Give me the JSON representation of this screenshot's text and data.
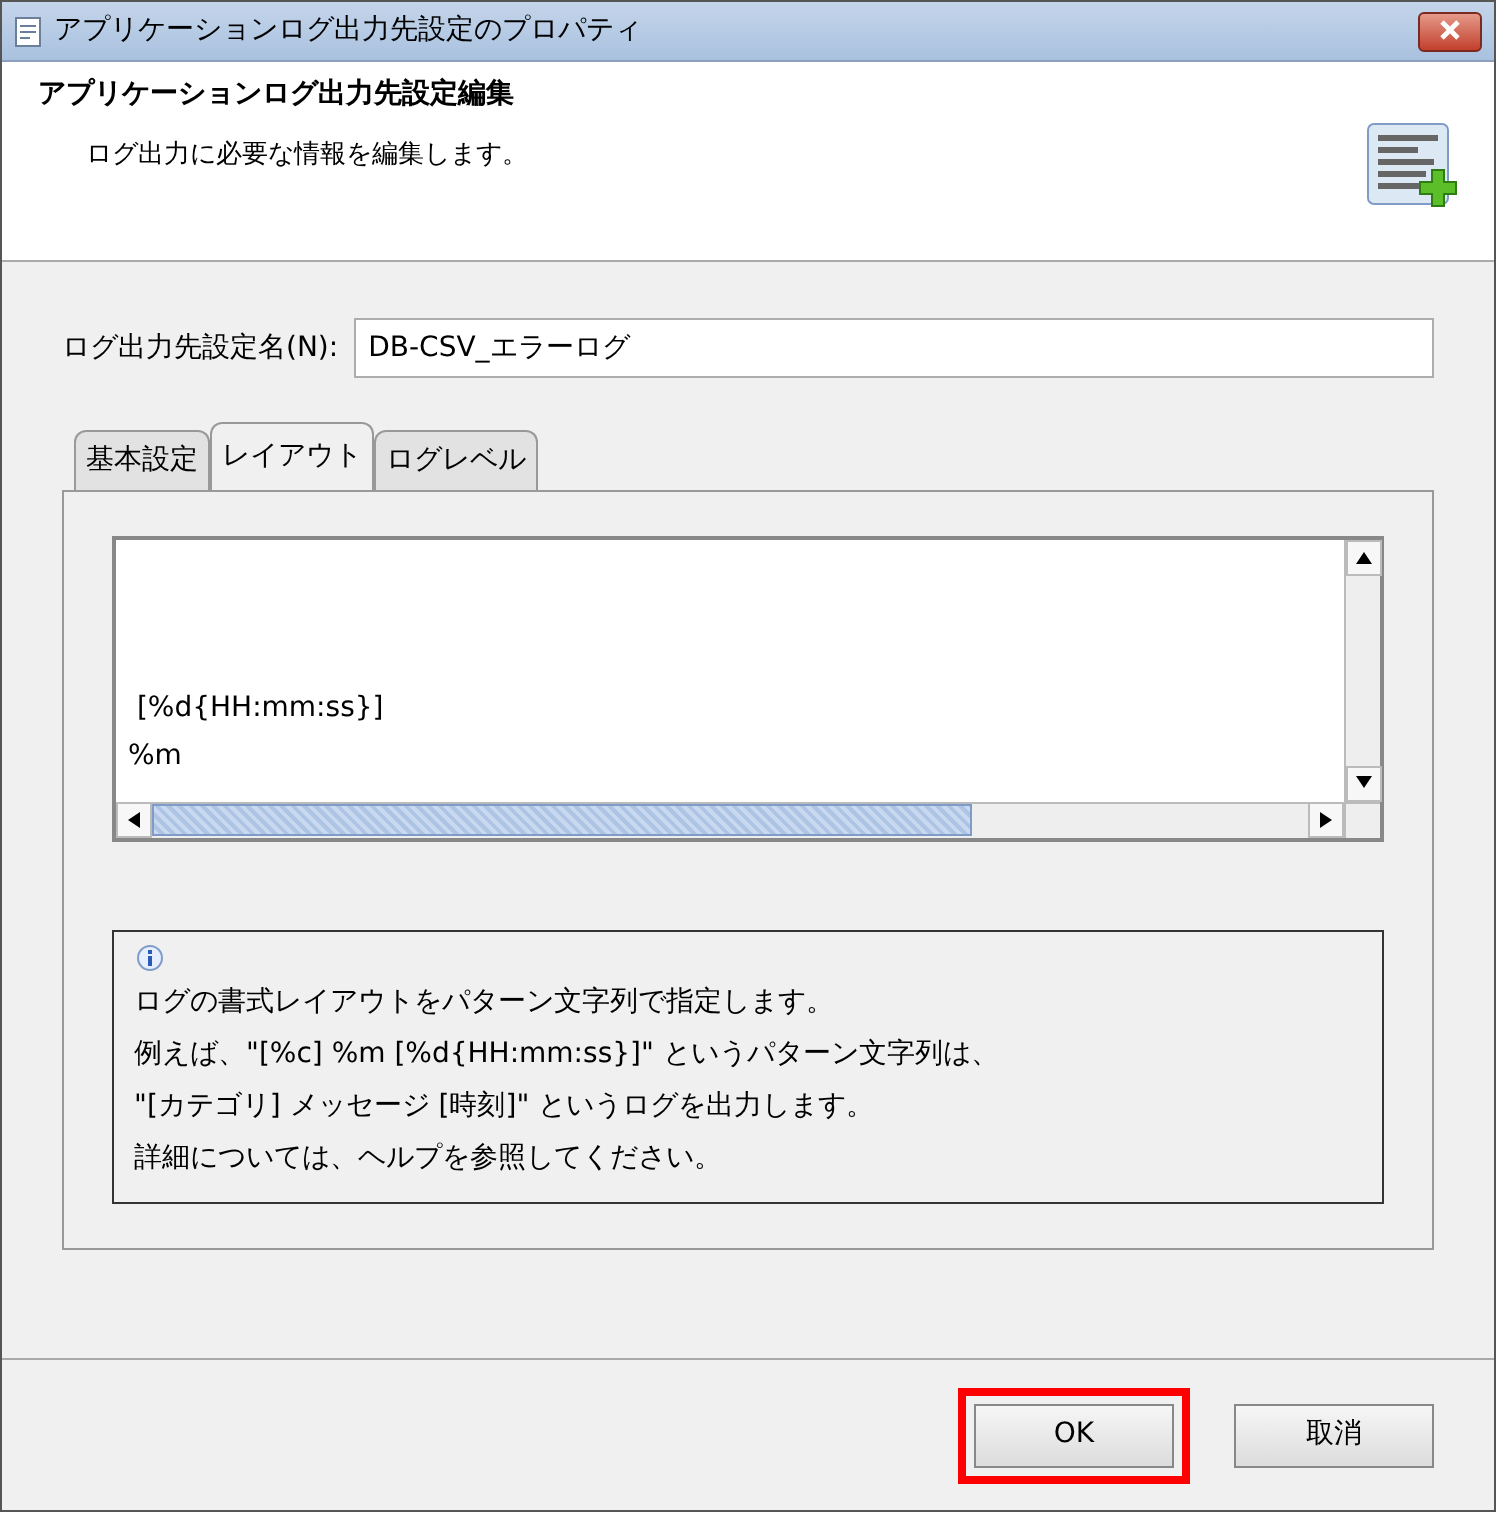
{
  "window": {
    "title": "アプリケーションログ出力先設定のプロパティ"
  },
  "header": {
    "title": "アプリケーションログ出力先設定編集",
    "description": "ログ出力に必要な情報を編集します。"
  },
  "name_field": {
    "label": "ログ出力先設定名(N):",
    "value": "DB-CSV_エラーログ"
  },
  "tabs": [
    {
      "label": "基本設定",
      "selected": false
    },
    {
      "label": "レイアウト",
      "selected": true
    },
    {
      "label": "ログレベル",
      "selected": false
    }
  ],
  "pattern_lines": [
    " [%d{HH:mm:ss}]",
    "%m"
  ],
  "info_lines": [
    "ログの書式レイアウトをパターン文字列で指定します。",
    "例えば、\"[%c] %m [%d{HH:mm:ss}]\" というパターン文字列は、",
    "\"[カテゴリ] メッセージ [時刻]\" というログを出力します。",
    "詳細については、ヘルプを参照してください。"
  ],
  "buttons": [
    {
      "label": "OK",
      "highlighted": true
    },
    {
      "label": "取消",
      "highlighted": false
    }
  ]
}
